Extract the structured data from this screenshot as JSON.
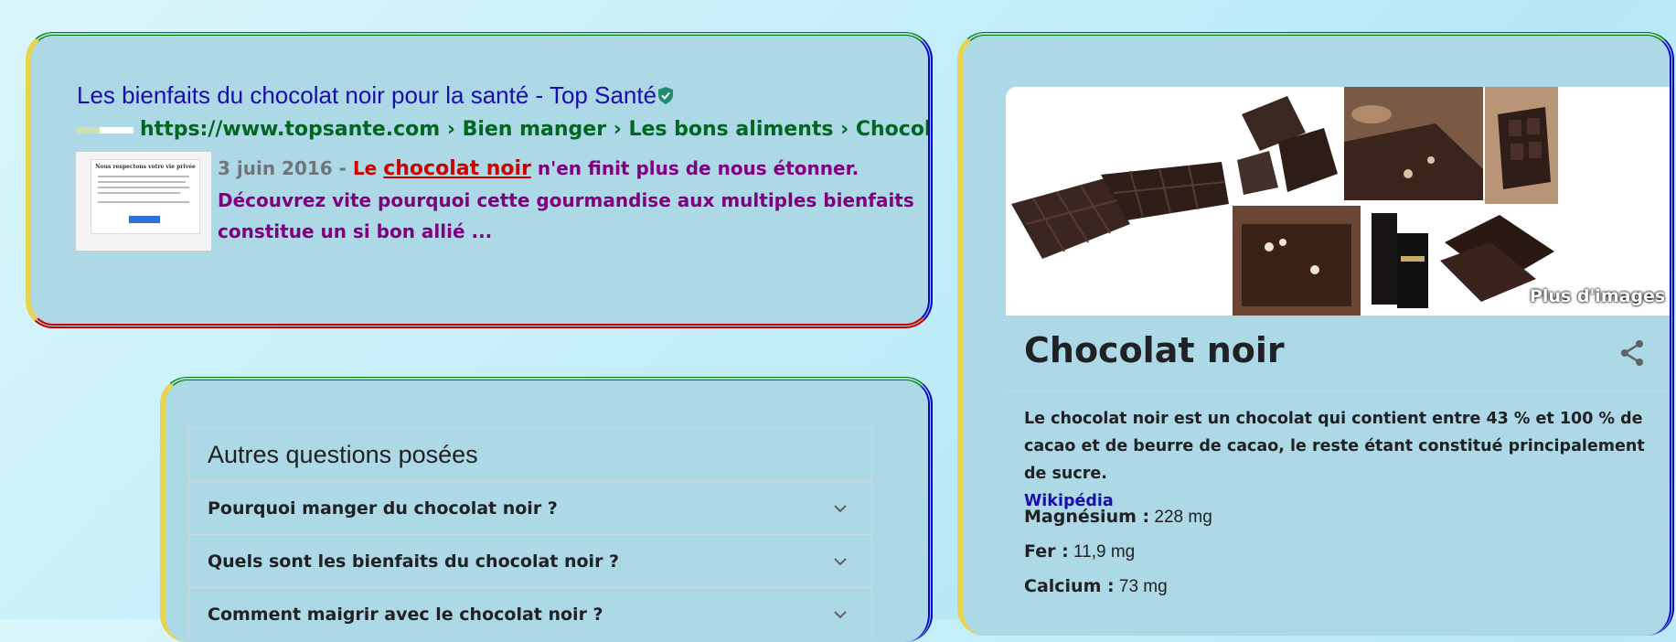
{
  "result": {
    "title": "Les bienfaits du chocolat noir pour la santé - Top Santé",
    "url": "https://www.topsante.com › Bien manger › Les bons aliments › Chocolat",
    "thumbnail_title": "Nous respectons votre vie privée",
    "date": "3 juin 2016 -",
    "snippet_prefix": "Le",
    "snippet_em": "chocolat noir",
    "snippet_rest": " n'en finit plus de nous étonner. Découvrez vite pourquoi cette gourmandise aux multiples bienfaits constitue un si bon allié ..."
  },
  "paa": {
    "heading": "Autres questions posées",
    "questions": [
      "Pourquoi manger du chocolat noir ?",
      "Quels sont les bienfaits du chocolat noir ?",
      "Comment maigrir avec le chocolat noir ?"
    ]
  },
  "knowledge_panel": {
    "more_images": "Plus d'images",
    "title": "Chocolat noir",
    "description": "Le chocolat noir est un chocolat qui contient entre 43 % et 100 % de cacao et de beurre de cacao, le reste étant constitué principalement de sucre.",
    "source": "Wikipédia",
    "facts": [
      {
        "label": "Magnésium :",
        "value": "228 mg"
      },
      {
        "label": "Fer :",
        "value": "11,9 mg"
      },
      {
        "label": "Calcium :",
        "value": "73 mg"
      }
    ]
  },
  "colors": {
    "panel_bg": "#add8e6",
    "title_link": "#1a0dab",
    "url_green": "#006621",
    "snippet_purple": "#800080",
    "highlight_red": "#cc0000"
  }
}
